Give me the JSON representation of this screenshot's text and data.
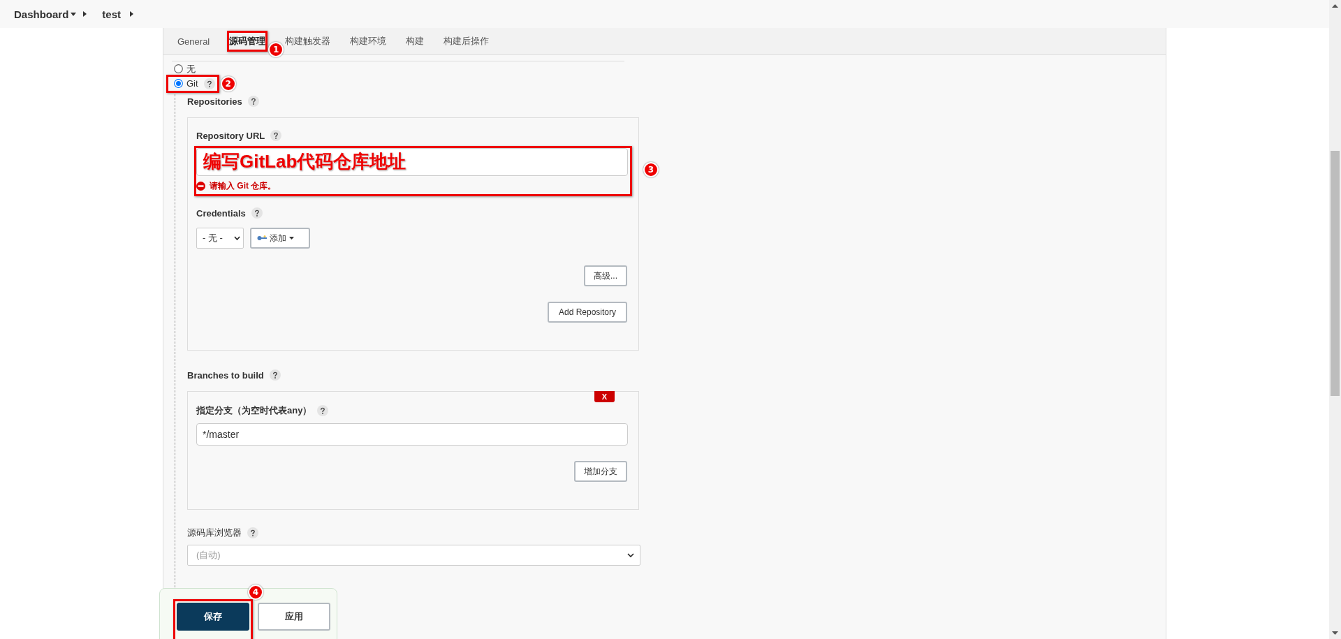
{
  "breadcrumb": [
    {
      "label": "Dashboard",
      "dropdown": true
    },
    {
      "label": "test",
      "dropdown": false
    }
  ],
  "tabs": [
    {
      "label": "General",
      "selected": false,
      "annotated": false
    },
    {
      "label": "源码管理",
      "selected": true,
      "annotated": true
    },
    {
      "label": "构建触发器",
      "selected": false,
      "annotated": false
    },
    {
      "label": "构建环境",
      "selected": false,
      "annotated": false
    },
    {
      "label": "构建",
      "selected": false,
      "annotated": false
    },
    {
      "label": "构建后操作",
      "selected": false,
      "annotated": false
    }
  ],
  "scm_options": [
    {
      "label": "无",
      "selected": false,
      "help": false
    },
    {
      "label": "Git",
      "selected": true,
      "help": true
    }
  ],
  "repositories": {
    "label": "Repositories",
    "url_label": "Repository URL",
    "error": "请输入 Git 仓库。",
    "credentials_label": "Credentials",
    "credentials_value": "- 无 -",
    "add_button": "添加",
    "advanced_button": "高级...",
    "add_repository_button": "Add Repository"
  },
  "branches": {
    "label": "Branches to build",
    "delete_button": "X",
    "branch_label": "指定分支（为空时代表any）",
    "branch_value": "*/master",
    "add_branch_button": "增加分支"
  },
  "browser": {
    "label": "源码库浏览器",
    "value": "(自动)"
  },
  "actions": [
    {
      "label": "保存",
      "primary": true
    },
    {
      "label": "应用",
      "primary": false
    }
  ],
  "annotations": [
    {
      "number": "1"
    },
    {
      "number": "2"
    },
    {
      "number": "3",
      "text": "编写GitLab代码仓库地址"
    },
    {
      "number": "4"
    }
  ]
}
